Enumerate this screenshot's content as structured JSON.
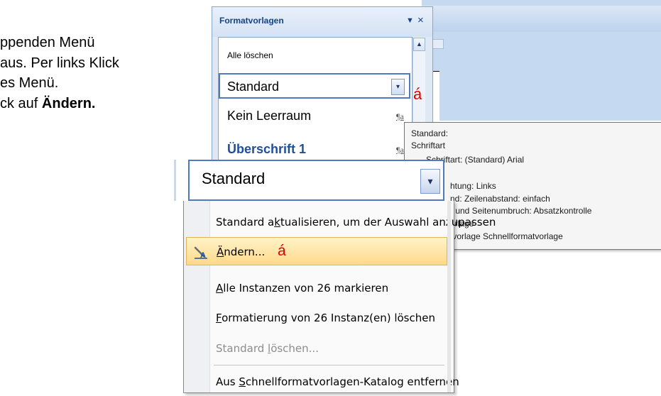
{
  "background_text": {
    "line1": "ppenden Menü",
    "line2": "aus. Per links Klick",
    "line3": "es Menü.",
    "line4_prefix": "ck auf ",
    "line4_bold": "Ändern."
  },
  "styles_pane": {
    "title": "Formatvorlagen",
    "close": "×",
    "items": {
      "clear_all": "Alle löschen",
      "standard": "Standard",
      "kein_leerraum": "Kein Leerraum",
      "ueberschrift1": "Überschrift 1"
    },
    "para_mark": "¶a",
    "red_marker": "á"
  },
  "tooltip": {
    "lines": [
      "Standard:",
      "Schriftart",
      "Schriftart:  (Standard) Arial",
      "htung:  Links",
      "nd:  Zeilenabstand:  einfach",
      "- und Seitenumbruch:  Absatzkontrolle",
      "orlage",
      "tvorlage Schnellformatvorlage"
    ]
  },
  "combo": {
    "value": "Standard"
  },
  "context_menu": {
    "items": [
      {
        "pre": "Standard a",
        "ul": "k",
        "post": "tualisieren, um der Auswahl anzupassen"
      },
      {
        "pre": "",
        "ul": "Ä",
        "post": "ndern...",
        "marker": "á"
      },
      {
        "pre": "",
        "ul": "A",
        "post": "lle Instanzen von 26 markieren"
      },
      {
        "pre": "",
        "ul": "F",
        "post": "ormatierung von 26 Instanz(en) löschen"
      },
      {
        "pre": "Standard ",
        "ul": "l",
        "post": "öschen..."
      },
      {
        "pre": "Aus ",
        "ul": "S",
        "post": "chnellformatvorlagen-Katalog entfernen"
      }
    ]
  },
  "colors": {
    "highlight": "#ffd98a",
    "accent": "#4d7bbe",
    "marker": "#e00000",
    "pane_title": "#15428b"
  }
}
